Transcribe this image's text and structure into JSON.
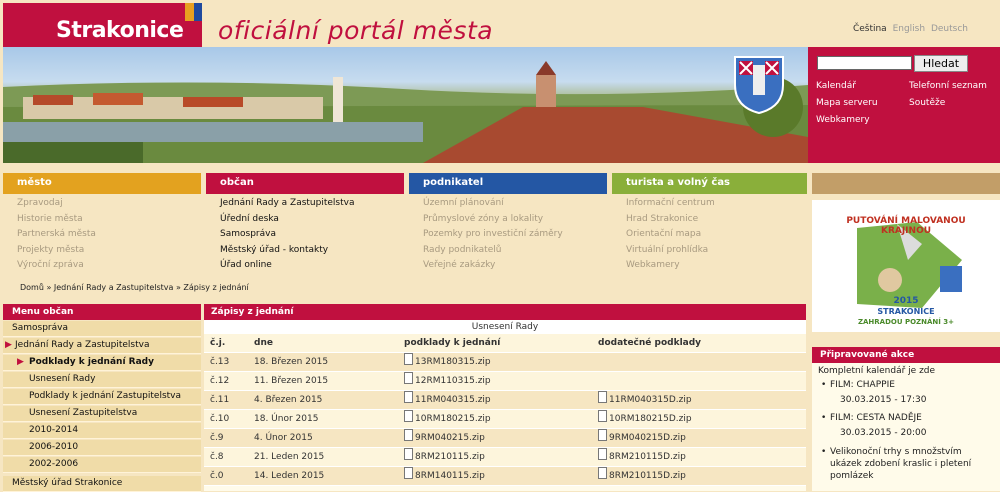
{
  "header": {
    "city": "Strakonice",
    "portal_title": "oficiální portál města",
    "languages": [
      "Čeština",
      "English",
      "Deutsch"
    ]
  },
  "search": {
    "placeholder": "",
    "button": "Hledat"
  },
  "quick_links": [
    "Kalendář",
    "Telefonní seznam",
    "Mapa serveru",
    "Soutěže",
    "Webkamery"
  ],
  "nav": {
    "mesto": {
      "title": "město",
      "color": "#e3a21f",
      "items": [
        "Zpravodaj",
        "Historie města",
        "Partnerská města",
        "Projekty města",
        "Výroční zpráva"
      ]
    },
    "obcan": {
      "title": "občan",
      "color": "#c0103f",
      "items": [
        "Jednání Rady a Zastupitelstva",
        "Úřední deska",
        "Samospráva",
        "Městský úřad - kontakty",
        "Úřad online"
      ]
    },
    "podnikatel": {
      "title": "podnikatel",
      "color": "#2457a4",
      "items": [
        "Územní plánování",
        "Průmyslové zóny a lokality",
        "Pozemky pro investiční záměry",
        "Rady podnikatelů",
        "Veřejné zakázky"
      ]
    },
    "turista": {
      "title": "turista a volný čas",
      "color": "#8aaf3a",
      "items": [
        "Informační centrum",
        "Hrad Strakonice",
        "Orientační mapa",
        "Virtuální prohlídka",
        "Webkamery"
      ]
    }
  },
  "breadcrumb": "Domů » Jednání Rady a Zastupitelstva » Zápisy z jednání",
  "sidebar": {
    "title": "Menu občan",
    "items": [
      "Samospráva",
      "Jednání Rady a Zastupitelstva",
      "Podklady k jednání Rady",
      "Usnesení Rady",
      "Podklady k jednání Zastupitelstva",
      "Usnesení Zastupitelstva",
      "2010-2014",
      "2006-2010",
      "2002-2006",
      "Městský úřad Strakonice"
    ]
  },
  "main": {
    "title": "Zápisy z jednání",
    "subtitle": "Usnesení Rady",
    "columns": [
      "č.j.",
      "dne",
      "podklady k jednání",
      "dodatečné podklady"
    ],
    "rows": [
      [
        "č.13",
        "18. Březen 2015",
        "13RM180315.zip",
        ""
      ],
      [
        "č.12",
        "11. Březen 2015",
        "12RM110315.zip",
        ""
      ],
      [
        "č.11",
        "4. Březen 2015",
        "11RM040315.zip",
        "11RM040315D.zip"
      ],
      [
        "č.10",
        "18. Únor 2015",
        "10RM180215.zip",
        "10RM180215D.zip"
      ],
      [
        "č.9",
        "4. Únor 2015",
        "9RM040215.zip",
        "9RM040215D.zip"
      ],
      [
        "č.8",
        "21. Leden 2015",
        "8RM210115.zip",
        "8RM210115D.zip"
      ],
      [
        "č.0",
        "14. Leden 2015",
        "8RM140115.zip",
        "8RM210115D.zip"
      ]
    ]
  },
  "promo": {
    "lines": [
      "PUTOVÁNÍ MALOVANOU KRAJINOU",
      "2015",
      "STRAKONICE",
      "ZAHRADOU POZNÁNÍ 3+"
    ]
  },
  "events": {
    "title": "Připravované akce",
    "link": "Kompletní kalendář je zde",
    "items": [
      {
        "name": "FILM: CHAPPIE",
        "date": "30.03.2015 - 17:30"
      },
      {
        "name": "FILM: CESTA NADĚJE",
        "date": "30.03.2015 - 20:00"
      },
      {
        "name": "Velikonoční trhy s množstvím ukázek zdobení kraslic i pletení pomlázek",
        "date": ""
      }
    ]
  },
  "colors": {
    "brand": "#c0103f",
    "background": "#f6e6c2"
  }
}
